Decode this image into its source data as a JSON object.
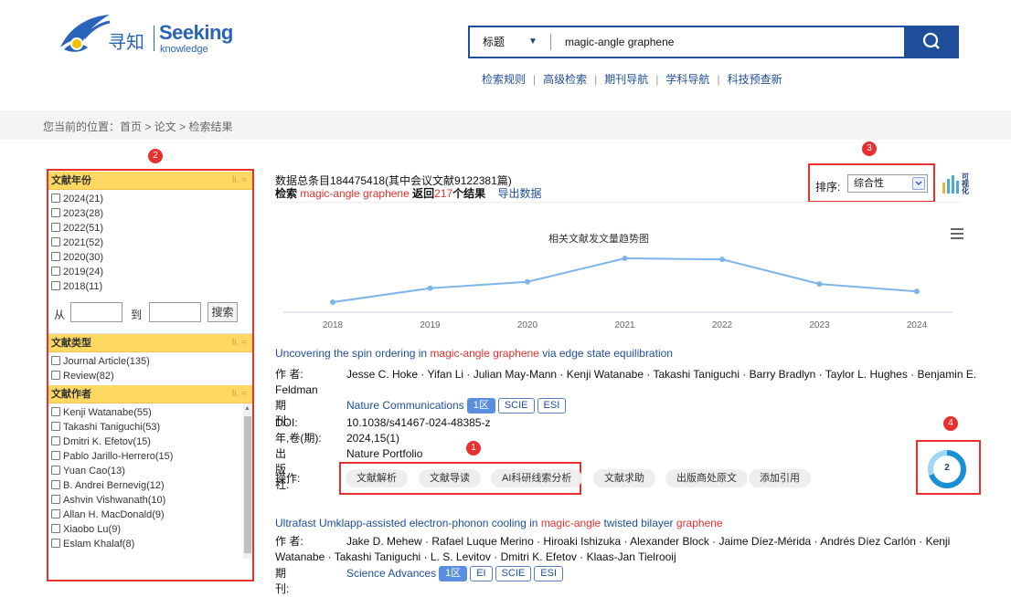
{
  "header": {
    "logo_cn": "寻知",
    "logo_en": "Seeking",
    "logo_en_sub": "knowledge",
    "search_field": "标题",
    "search_query": "magic-angle graphene",
    "nav": [
      "检索规则",
      "高级检索",
      "期刊导航",
      "学科导航",
      "科技预查新"
    ]
  },
  "breadcrumb": {
    "prefix": "您当前的位置：",
    "items": [
      "首页",
      "论文",
      "检索结果"
    ],
    "separator": ">"
  },
  "badges": [
    "1",
    "2",
    "3",
    "4"
  ],
  "sidebar": {
    "year": {
      "title": "文献年份",
      "options": [
        "2024(21)",
        "2023(28)",
        "2022(51)",
        "2021(52)",
        "2020(30)",
        "2019(24)",
        "2018(11)"
      ],
      "from_label": "从",
      "to_label": "到",
      "search_button": "搜索"
    },
    "type": {
      "title": "文献类型",
      "options": [
        "Journal Article(135)",
        "Review(82)"
      ]
    },
    "author": {
      "title": "文献作者",
      "options": [
        "Kenji Watanabe(55)",
        "Takashi Taniguchi(53)",
        "Dmitri K. Efetov(15)",
        "Pablo Jarillo-Herrero(15)",
        "Yuan Cao(13)",
        "B. Andrei Bernevig(12)",
        "Ashvin Vishwanath(10)",
        "Allan H. MacDonald(9)",
        "Xiaobo Lu(9)",
        "Eslam Khalaf(8)"
      ]
    }
  },
  "stats": {
    "line1": "数据总条目184475418(其中会议文献9122381篇)",
    "search_word": "检索",
    "query": "magic-angle graphene",
    "return_word": "返回",
    "count": "217",
    "results_word": "个结果",
    "export": "导出数据"
  },
  "sort": {
    "label": "排序:",
    "value": "综合性"
  },
  "visualize_label": "可视化",
  "chart_data": {
    "type": "line",
    "title": "相关文献发文量趋势图",
    "categories": [
      "2018",
      "2019",
      "2020",
      "2021",
      "2022",
      "2023",
      "2024"
    ],
    "values": [
      11,
      24,
      30,
      52,
      51,
      28,
      21
    ],
    "color": "#7cb5ec",
    "grid": false,
    "legend": "none"
  },
  "results": [
    {
      "title_pre": "Uncovering the spin ordering in ",
      "title_hl": "magic-angle graphene",
      "title_post": " via edge state equilibration",
      "authors_label": "作 者:",
      "authors": "Jesse C. Hoke · Yifan Li · Julian May-Mann · Kenji Watanabe · Takashi Taniguchi · Barry Bradlyn · Taylor L. Hughes · Benjamin E.",
      "authors_cont": "Feldman",
      "journal_label": "期 刊:",
      "journal": "Nature Communications",
      "journal_tags": [
        "1区",
        "SCIE",
        "ESI"
      ],
      "doi_label": "DOI:",
      "doi": "10.1038/s41467-024-48385-z",
      "vol_label": "年,卷(期):",
      "vol": "2024,15(1)",
      "pub_label": "出版社:",
      "publisher": "Nature Portfolio",
      "ops_label": "操作:",
      "ops": [
        "文献解析",
        "文献导读",
        "AI科研线索分析",
        "文献求助",
        "出版商处原文",
        "添加引用"
      ],
      "score": "2"
    },
    {
      "title_pre": "Ultrafast Umklapp-assisted electron-phonon cooling in ",
      "title_hl": "magic-angle",
      "title_mid": " twisted bilayer ",
      "title_hl2": "graphene",
      "authors_label": "作 者:",
      "authors": "Jake D. Mehew · Rafael Luque Merino · Hiroaki Ishizuka · Alexander Block · Jaime Díez-Mérida · Andrés Díez Carlón · Kenji",
      "authors_cont": "Watanabe · Takashi Taniguchi · L. S. Levitov · Dmitri K. Efetov · Klaas-Jan Tielrooij",
      "journal_label": "期 刊:",
      "journal": "Science Advances",
      "journal_tags": [
        "1区",
        "EI",
        "SCIE",
        "ESI"
      ]
    }
  ]
}
